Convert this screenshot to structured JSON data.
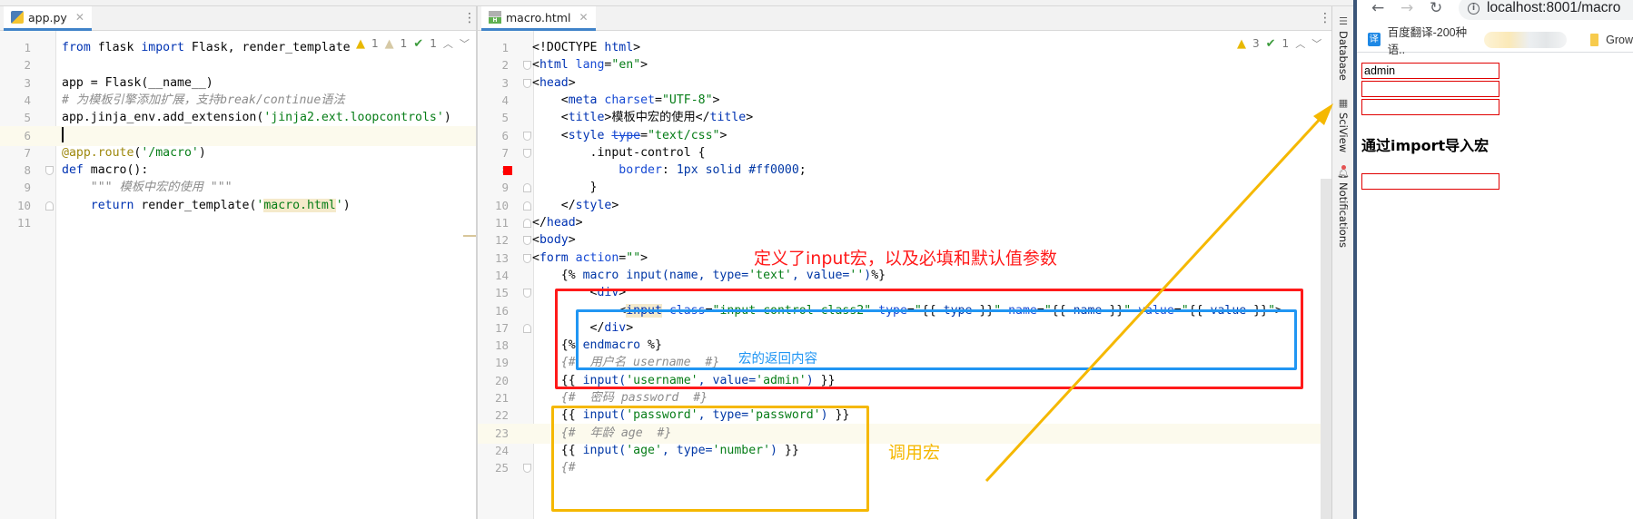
{
  "left_editor": {
    "tab": {
      "label": "app.py",
      "icon": "python-file-icon"
    },
    "inspections": {
      "warnings": "1",
      "weak_warnings": "1",
      "typos": "1"
    },
    "current_line": 6,
    "lines": [
      {
        "n": "1",
        "segments": [
          [
            "kw",
            "from"
          ],
          [
            "plain",
            " flask "
          ],
          [
            "kw",
            "import"
          ],
          [
            "plain",
            " Flask, render_template"
          ]
        ]
      },
      {
        "n": "2",
        "segments": []
      },
      {
        "n": "3",
        "segments": [
          [
            "plain",
            "app = Flask(__name__)"
          ]
        ]
      },
      {
        "n": "4",
        "segments": [
          [
            "cm",
            "# 为模板引擎添加扩展，支持break/continue语法"
          ]
        ]
      },
      {
        "n": "5",
        "segments": [
          [
            "plain",
            "app.jinja_env.add_extension("
          ],
          [
            "str",
            "'jinja2.ext.loopcontrols'"
          ],
          [
            "plain",
            ")"
          ]
        ]
      },
      {
        "n": "6",
        "segments": []
      },
      {
        "n": "7",
        "segments": [
          [
            "dec",
            "@app.route"
          ],
          [
            "plain",
            "("
          ],
          [
            "str",
            "'/macro'"
          ],
          [
            "plain",
            ")"
          ]
        ]
      },
      {
        "n": "8",
        "segments": [
          [
            "kw",
            "def"
          ],
          [
            "plain",
            " macro():"
          ]
        ]
      },
      {
        "n": "9",
        "segments": [
          [
            "cm",
            "    \"\"\" 模板中宏的使用 \"\"\""
          ]
        ]
      },
      {
        "n": "10",
        "segments": [
          [
            "plain",
            "    "
          ],
          [
            "kw",
            "return"
          ],
          [
            "plain",
            " render_template("
          ],
          [
            "str",
            "'"
          ],
          [
            "str hl",
            "macro.html"
          ],
          [
            "str",
            "'"
          ],
          [
            "plain",
            ")"
          ]
        ]
      },
      {
        "n": "11",
        "segments": []
      }
    ]
  },
  "right_editor": {
    "tab": {
      "label": "macro.html",
      "icon": "html-file-icon"
    },
    "inspections": {
      "warnings": "3",
      "typos": "1"
    },
    "current_line": 23,
    "lines": [
      {
        "n": "1",
        "segments": [
          [
            "plain",
            "<!DOCTYPE "
          ],
          [
            "tag",
            "html"
          ],
          [
            "plain",
            ">"
          ]
        ]
      },
      {
        "n": "2",
        "segments": [
          [
            "plain",
            "<"
          ],
          [
            "tag",
            "html"
          ],
          [
            "attr",
            " lang"
          ],
          [
            "plain",
            "="
          ],
          [
            "str",
            "\"en\""
          ],
          [
            "plain",
            ">"
          ]
        ]
      },
      {
        "n": "3",
        "segments": [
          [
            "plain",
            "<"
          ],
          [
            "tag",
            "head"
          ],
          [
            "plain",
            ">"
          ]
        ]
      },
      {
        "n": "4",
        "segments": [
          [
            "plain",
            "    <"
          ],
          [
            "tag",
            "meta"
          ],
          [
            "attr",
            " charset"
          ],
          [
            "plain",
            "="
          ],
          [
            "str",
            "\"UTF-8\""
          ],
          [
            "plain",
            ">"
          ]
        ]
      },
      {
        "n": "5",
        "segments": [
          [
            "plain",
            "    <"
          ],
          [
            "tag",
            "title"
          ],
          [
            "plain",
            ">模板中宏的使用</"
          ],
          [
            "tag",
            "title"
          ],
          [
            "plain",
            ">"
          ]
        ]
      },
      {
        "n": "6",
        "segments": [
          [
            "plain",
            "    <"
          ],
          [
            "tag",
            "style"
          ],
          [
            "plain",
            " "
          ],
          [
            "attr strike",
            "type"
          ],
          [
            "plain",
            "="
          ],
          [
            "str",
            "\"text/css\""
          ],
          [
            "plain",
            ">"
          ]
        ]
      },
      {
        "n": "7",
        "segments": [
          [
            "plain",
            "        .input-control {"
          ]
        ]
      },
      {
        "n": "8",
        "segments": [
          [
            "plain",
            "            "
          ],
          [
            "attr",
            "border"
          ],
          [
            "plain",
            ": "
          ],
          [
            "tpl",
            "1px solid #ff0000"
          ],
          [
            "plain",
            ";"
          ]
        ]
      },
      {
        "n": "9",
        "segments": [
          [
            "plain",
            "        }"
          ]
        ]
      },
      {
        "n": "10",
        "segments": [
          [
            "plain",
            "    </"
          ],
          [
            "tag",
            "style"
          ],
          [
            "plain",
            ">"
          ]
        ]
      },
      {
        "n": "11",
        "segments": [
          [
            "plain",
            "</"
          ],
          [
            "tag",
            "head"
          ],
          [
            "plain",
            ">"
          ]
        ]
      },
      {
        "n": "12",
        "segments": [
          [
            "plain",
            "<"
          ],
          [
            "tag",
            "body"
          ],
          [
            "plain",
            ">"
          ]
        ]
      },
      {
        "n": "13",
        "segments": [
          [
            "plain",
            "<"
          ],
          [
            "tag",
            "form"
          ],
          [
            "attr",
            " action"
          ],
          [
            "plain",
            "="
          ],
          [
            "str",
            "\"\""
          ],
          [
            "plain",
            ">"
          ]
        ]
      },
      {
        "n": "14",
        "segments": [
          [
            "plain",
            "    {% "
          ],
          [
            "tpl",
            "macro input(name, type="
          ],
          [
            "str",
            "'text'"
          ],
          [
            "tpl",
            ", value="
          ],
          [
            "str",
            "''"
          ],
          [
            "tpl",
            ")"
          ],
          [
            "plain",
            "%}"
          ]
        ]
      },
      {
        "n": "15",
        "segments": [
          [
            "plain",
            "        <"
          ],
          [
            "tag",
            "div"
          ],
          [
            "plain",
            ">"
          ]
        ]
      },
      {
        "n": "16",
        "segments": [
          [
            "plain",
            "            <"
          ],
          [
            "tag hl",
            "input"
          ],
          [
            "attr",
            " class"
          ],
          [
            "plain",
            "="
          ],
          [
            "str",
            "\"input-control class2\""
          ],
          [
            "attr",
            " type"
          ],
          [
            "plain",
            "="
          ],
          [
            "str",
            "\""
          ],
          [
            "plain",
            "{{ "
          ],
          [
            "tpl",
            "type"
          ],
          [
            "plain",
            " }}"
          ],
          [
            "str",
            "\""
          ],
          [
            "attr",
            " name"
          ],
          [
            "plain",
            "="
          ],
          [
            "str",
            "\""
          ],
          [
            "plain",
            "{{ "
          ],
          [
            "tpl",
            "name"
          ],
          [
            "plain",
            " }}"
          ],
          [
            "str",
            "\""
          ],
          [
            "attr",
            " value"
          ],
          [
            "plain",
            "="
          ],
          [
            "str",
            "\""
          ],
          [
            "plain",
            "{{ "
          ],
          [
            "tpl",
            "value"
          ],
          [
            "plain",
            " }}"
          ],
          [
            "str",
            "\""
          ],
          [
            "plain",
            ">"
          ]
        ]
      },
      {
        "n": "17",
        "segments": [
          [
            "plain",
            "        </"
          ],
          [
            "tag",
            "div"
          ],
          [
            "plain",
            ">"
          ]
        ]
      },
      {
        "n": "18",
        "segments": [
          [
            "plain",
            "    {% "
          ],
          [
            "tpl",
            "endmacro"
          ],
          [
            "plain",
            " %}"
          ]
        ]
      },
      {
        "n": "19",
        "segments": [
          [
            "cm",
            "    {#  用户名 username  #}"
          ]
        ]
      },
      {
        "n": "20",
        "segments": [
          [
            "plain",
            "    {{ "
          ],
          [
            "tpl",
            "input("
          ],
          [
            "str",
            "'username'"
          ],
          [
            "tpl",
            ", value="
          ],
          [
            "str",
            "'admin'"
          ],
          [
            "tpl",
            ")"
          ],
          [
            "plain",
            " }}"
          ]
        ]
      },
      {
        "n": "21",
        "segments": [
          [
            "cm",
            "    {#  密码 password  #}"
          ]
        ]
      },
      {
        "n": "22",
        "segments": [
          [
            "plain",
            "    {{ "
          ],
          [
            "tpl",
            "input("
          ],
          [
            "str",
            "'password'"
          ],
          [
            "tpl",
            ", type="
          ],
          [
            "str",
            "'password'"
          ],
          [
            "tpl",
            ")"
          ],
          [
            "plain",
            " }}"
          ]
        ]
      },
      {
        "n": "23",
        "segments": [
          [
            "cm",
            "    {#  年龄 age  #}"
          ]
        ]
      },
      {
        "n": "24",
        "segments": [
          [
            "plain",
            "    {{ "
          ],
          [
            "tpl",
            "input("
          ],
          [
            "str",
            "'age'"
          ],
          [
            "tpl",
            ", type="
          ],
          [
            "str",
            "'number'"
          ],
          [
            "tpl",
            ")"
          ],
          [
            "plain",
            " }}"
          ]
        ]
      },
      {
        "n": "25",
        "segments": [
          [
            "cm",
            "    {#"
          ]
        ]
      }
    ]
  },
  "tool_strip": {
    "items": [
      {
        "label": "Database",
        "icon": "database-icon"
      },
      {
        "label": "SciView",
        "icon": "sciview-icon"
      },
      {
        "label": "Notifications",
        "icon": "bell-icon"
      }
    ]
  },
  "browser": {
    "url": "localhost:8001/macro",
    "bookmarks": [
      {
        "label": "百度翻译-200种语..",
        "icon": "translate-icon"
      },
      {
        "label": "Grow",
        "icon": "folder-icon"
      }
    ],
    "page": {
      "inputs_top": [
        {
          "value": "admin"
        },
        {
          "value": ""
        },
        {
          "value": ""
        }
      ],
      "heading": "通过import导入宏",
      "inputs_bottom": [
        {
          "value": ""
        }
      ]
    }
  },
  "annotations": {
    "macro_definition_label": "定义了input宏，以及必填和默认值参数",
    "macro_return_label": "宏的返回内容",
    "macro_call_label": "调用宏",
    "colors": {
      "red": "#ff1a1a",
      "blue": "#2196f3",
      "yellow": "#f5b800"
    }
  }
}
